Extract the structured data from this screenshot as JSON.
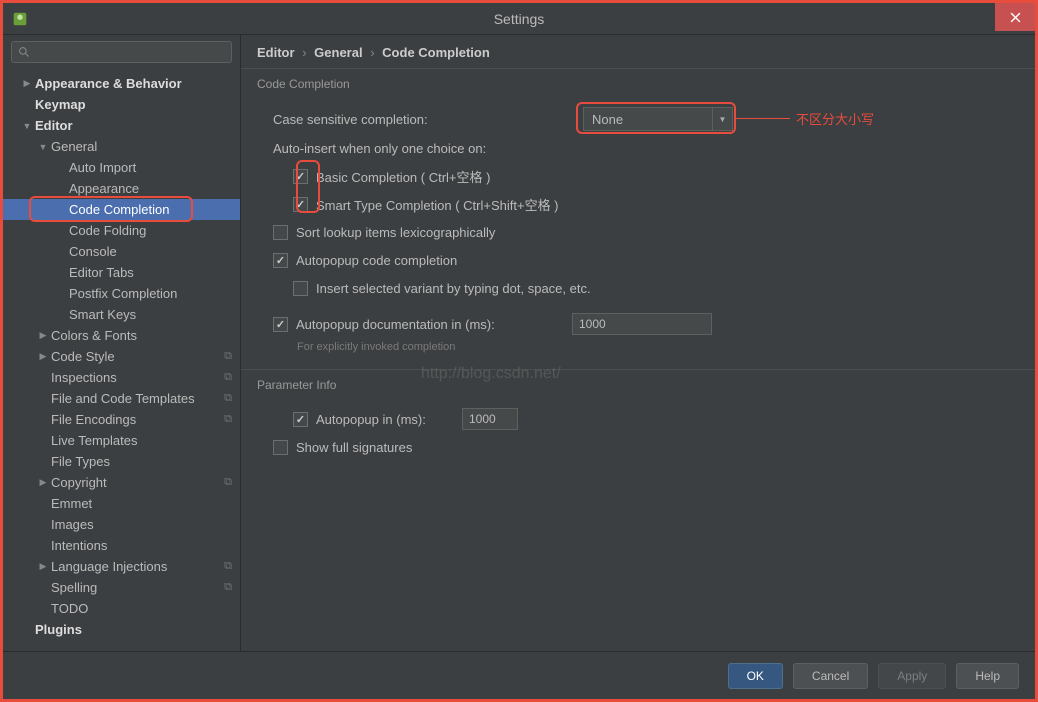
{
  "window": {
    "title": "Settings"
  },
  "breadcrumb": {
    "e": "Editor",
    "g": "General",
    "c": "Code Completion"
  },
  "sidebar": {
    "items": [
      {
        "label": "Appearance & Behavior",
        "level": 0,
        "arrow": "▶",
        "bold": true
      },
      {
        "label": "Keymap",
        "level": 0,
        "arrow": "",
        "bold": true
      },
      {
        "label": "Editor",
        "level": 0,
        "arrow": "▼",
        "bold": true
      },
      {
        "label": "General",
        "level": 1,
        "arrow": "▼"
      },
      {
        "label": "Auto Import",
        "level": 2,
        "arrow": ""
      },
      {
        "label": "Appearance",
        "level": 2,
        "arrow": ""
      },
      {
        "label": "Code Completion",
        "level": 2,
        "arrow": "",
        "selected": true
      },
      {
        "label": "Code Folding",
        "level": 2,
        "arrow": ""
      },
      {
        "label": "Console",
        "level": 2,
        "arrow": ""
      },
      {
        "label": "Editor Tabs",
        "level": 2,
        "arrow": ""
      },
      {
        "label": "Postfix Completion",
        "level": 2,
        "arrow": ""
      },
      {
        "label": "Smart Keys",
        "level": 2,
        "arrow": ""
      },
      {
        "label": "Colors & Fonts",
        "level": 1,
        "arrow": "▶"
      },
      {
        "label": "Code Style",
        "level": 1,
        "arrow": "▶",
        "copy": true
      },
      {
        "label": "Inspections",
        "level": 1,
        "arrow": "",
        "copy": true
      },
      {
        "label": "File and Code Templates",
        "level": 1,
        "arrow": "",
        "copy": true
      },
      {
        "label": "File Encodings",
        "level": 1,
        "arrow": "",
        "copy": true
      },
      {
        "label": "Live Templates",
        "level": 1,
        "arrow": ""
      },
      {
        "label": "File Types",
        "level": 1,
        "arrow": ""
      },
      {
        "label": "Copyright",
        "level": 1,
        "arrow": "▶",
        "copy": true
      },
      {
        "label": "Emmet",
        "level": 1,
        "arrow": ""
      },
      {
        "label": "Images",
        "level": 1,
        "arrow": ""
      },
      {
        "label": "Intentions",
        "level": 1,
        "arrow": ""
      },
      {
        "label": "Language Injections",
        "level": 1,
        "arrow": "▶",
        "copy": true
      },
      {
        "label": "Spelling",
        "level": 1,
        "arrow": "",
        "copy": true
      },
      {
        "label": "TODO",
        "level": 1,
        "arrow": ""
      },
      {
        "label": "Plugins",
        "level": 0,
        "arrow": "",
        "bold": true
      }
    ]
  },
  "sections": {
    "cc": "Code Completion",
    "pi": "Parameter Info"
  },
  "form": {
    "caseSensitiveLabel": "Case sensitive completion:",
    "caseSensitiveValue": "None",
    "autoInsertLabel": "Auto-insert when only one choice on:",
    "basicCompletion": "Basic Completion ( Ctrl+空格 )",
    "smartType": "Smart Type Completion ( Ctrl+Shift+空格 )",
    "sortLookup": "Sort lookup items lexicographically",
    "autopopupCode": "Autopopup code completion",
    "insertSelected": "Insert selected variant by typing dot, space, etc.",
    "autopopupDoc": "Autopopup documentation in (ms):",
    "autopopupDocVal": "1000",
    "docHint": "For explicitly invoked completion",
    "autopopupIn": "Autopopup in (ms):",
    "autopopupInVal": "1000",
    "showFull": "Show full signatures"
  },
  "footer": {
    "ok": "OK",
    "cancel": "Cancel",
    "apply": "Apply",
    "help": "Help"
  },
  "annotation": {
    "caseNote": "不区分大小写",
    "watermark": "http://blog.csdn.net/"
  }
}
